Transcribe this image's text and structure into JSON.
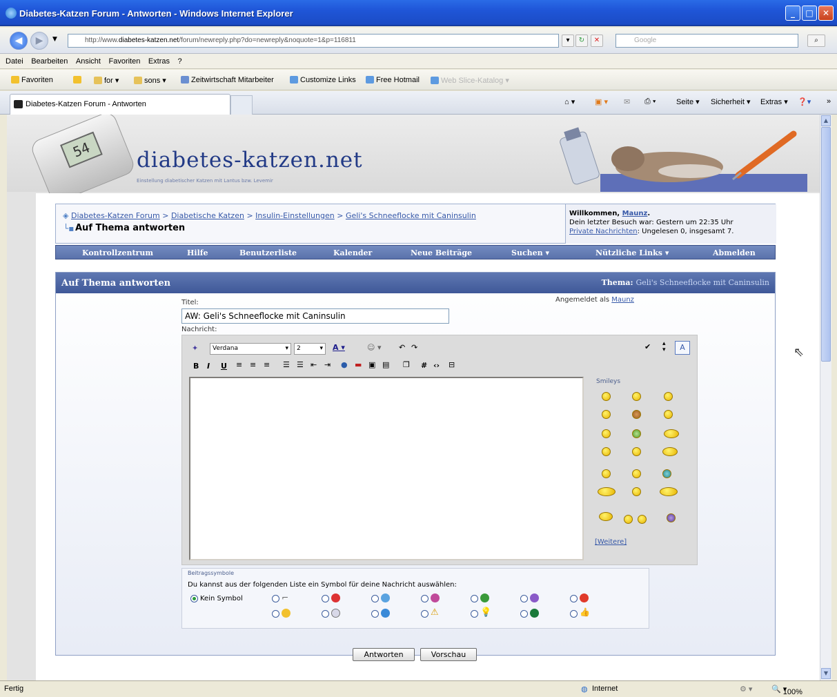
{
  "window": {
    "title": "Diabetes-Katzen Forum - Antworten - Windows Internet Explorer"
  },
  "address": {
    "url_prefix": "http://www.",
    "url_domain": "diabetes-katzen.net",
    "url_rest": "/forum/newreply.php?do=newreply&noquote=1&p=116811",
    "search_placeholder": "Google"
  },
  "menu": [
    "Datei",
    "Bearbeiten",
    "Ansicht",
    "Favoriten",
    "Extras",
    "?"
  ],
  "favorites": {
    "label": "Favoriten",
    "items": [
      "for ▾",
      "sons ▾",
      "Zeitwirtschaft Mitarbeiter",
      "Customize Links",
      "Free Hotmail",
      "Web Slice-Katalog ▾"
    ]
  },
  "tab": {
    "label": "Diabetes-Katzen Forum - Antworten"
  },
  "commandbar": {
    "seite": "Seite ▾",
    "sicherheit": "Sicherheit ▾",
    "extras": "Extras ▾"
  },
  "banner": {
    "site_title": "diabetes-katzen.net",
    "site_subtitle": "Einstellung diabetischer Katzen mit Lantus bzw. Levemir",
    "meter_value": "54"
  },
  "breadcrumb": {
    "items": [
      "Diabetes-Katzen Forum",
      "Diabetische Katzen",
      "Insulin-Einstellungen",
      "Geli's Schneeflocke mit Caninsulin"
    ],
    "current": "Auf Thema antworten"
  },
  "welcome": {
    "prefix": "Willkommen, ",
    "user": "Maunz",
    "line2": "Dein letzter Besuch war: Gestern um 22:35 Uhr",
    "pm_link": "Private Nachrichten",
    "pm_info": ": Ungelesen 0, insgesamt 7."
  },
  "nav": [
    "Kontrollzentrum",
    "Hilfe",
    "Benutzerliste",
    "Kalender",
    "Neue Beiträge",
    "Suchen ▾",
    "Nützliche Links ▾",
    "Abmelden"
  ],
  "reply": {
    "heading": "Auf Thema antworten",
    "thema_label": "Thema:",
    "thema_value": "Geli's Schneeflocke mit Caninsulin",
    "title_label": "Titel:",
    "title_value": "AW: Geli's Schneeflocke mit Caninsulin",
    "message_label": "Nachricht:",
    "logged_prefix": "Angemeldet als ",
    "logged_user": "Maunz",
    "font_value": "Verdana",
    "size_value": "2",
    "smilies_caption": "Smileys",
    "more_link": "[Weitere]",
    "post_icons_caption": "Beitragssymbole",
    "post_icons_desc": "Du kannst aus der folgenden Liste ein Symbol für deine Nachricht auswählen:",
    "no_icon_label": "Kein Symbol",
    "submit_label": "Antworten",
    "preview_label": "Vorschau"
  },
  "status": {
    "left": "Fertig",
    "zone": "Internet",
    "zoom": "100%"
  },
  "colors": {
    "accent": "#3f5898",
    "link": "#3658a8",
    "titlebar": "#1f56d8"
  }
}
